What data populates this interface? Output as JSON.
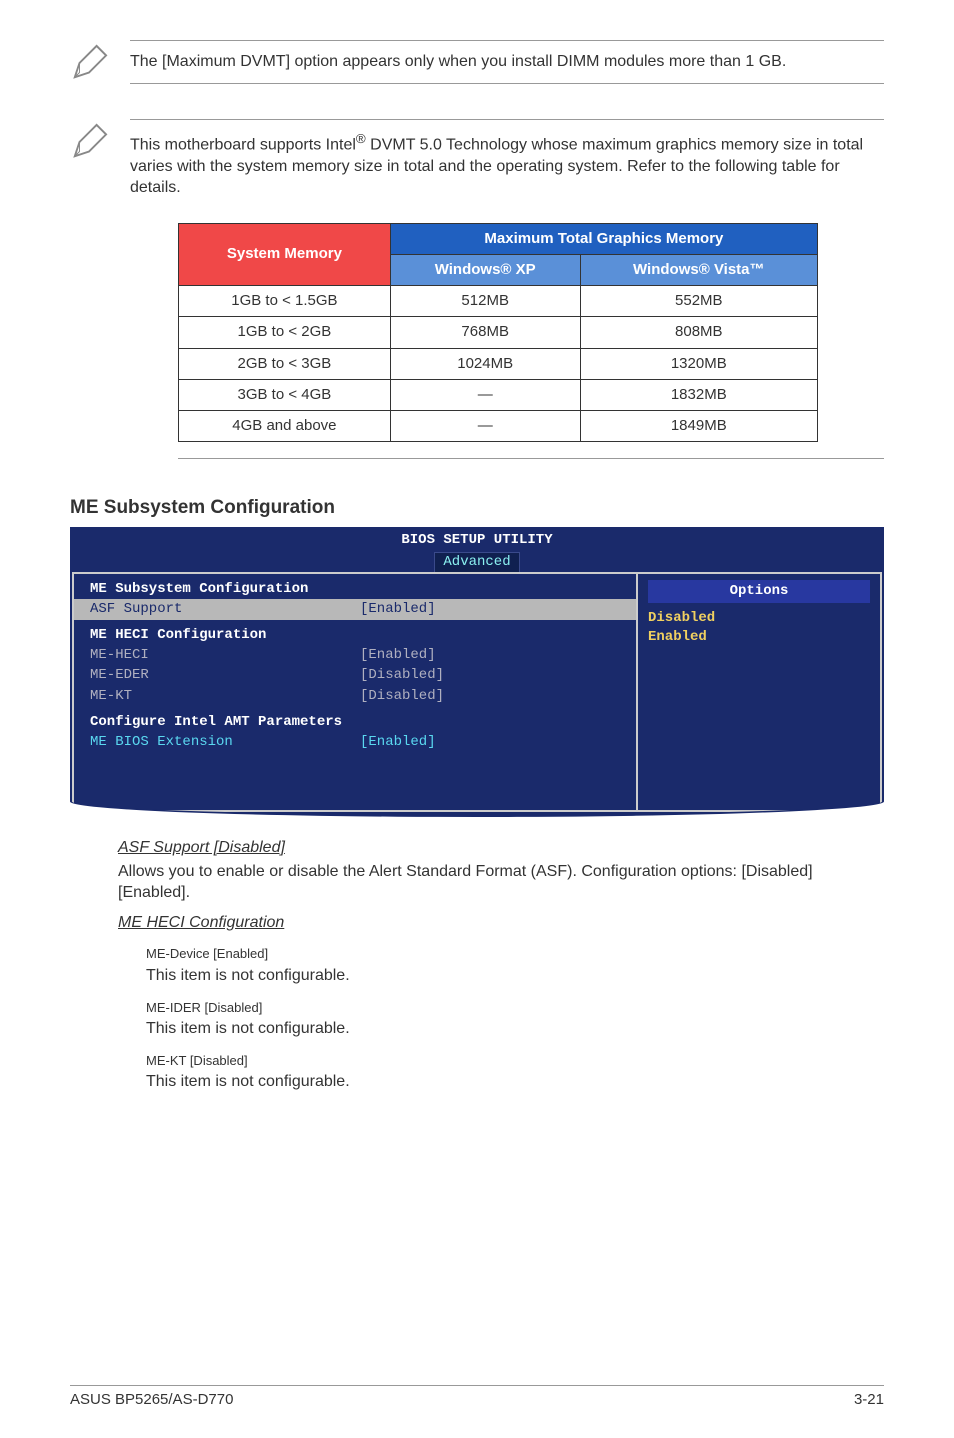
{
  "note1": "The [Maximum DVMT] option appears only when you install DIMM modules more than 1 GB.",
  "note2": {
    "pre": "This motherboard supports Intel",
    "reg": "®",
    "post": " DVMT 5.0 Technology whose maximum graphics memory size in total varies with the system memory size in total and the operating system. Refer to the following table for details."
  },
  "table": {
    "h_sysmem": "System Memory",
    "h_max": "Maximum Total Graphics Memory",
    "h_winxp": "Windows® XP",
    "h_winvista": "Windows® Vista™",
    "rows": [
      {
        "mem": "1GB to < 1.5GB",
        "xp": "512MB",
        "vista": "552MB"
      },
      {
        "mem": "1GB to < 2GB",
        "xp": "768MB",
        "vista": "808MB"
      },
      {
        "mem": "2GB to < 3GB",
        "xp": "1024MB",
        "vista": "1320MB"
      },
      {
        "mem": "3GB to < 4GB",
        "xp": "—",
        "vista": "1832MB"
      },
      {
        "mem": "4GB and above",
        "xp": "—",
        "vista": "1849MB"
      }
    ]
  },
  "section_heading": "ME Subsystem Configuration",
  "bios": {
    "title": "BIOS SETUP UTILITY",
    "tab": "Advanced",
    "subheader": "ME Subsystem Configuration",
    "asf_label": "ASF Support",
    "asf_val": "[Enabled]",
    "heci_header": "ME HECI Configuration",
    "me_heci_l": "ME-HECI",
    "me_heci_v": "[Enabled]",
    "me_eder_l": "ME-EDER",
    "me_eder_v": "[Disabled]",
    "me_kt_l": "ME-KT",
    "me_kt_v": "[Disabled]",
    "conf_intel": "Configure Intel AMT Parameters",
    "me_bios_l": "ME BIOS Extension",
    "me_bios_v": "[Enabled]",
    "options_header": "Options",
    "opt1": "Disabled",
    "opt2": "Enabled"
  },
  "body": {
    "asf_head": "ASF Support [Disabled]",
    "asf_p1": "Allows you to enable or disable the Alert Standard Format (ASF). Configuration options: [Disabled] [Enabled].",
    "heci_head": "ME HECI Configuration",
    "me_dev": "ME-Device [Enabled]",
    "not_conf": "This item is not configurable.",
    "me_ider": "ME-IDER [Disabled]",
    "me_kt": "ME-KT [Disabled]"
  },
  "footer": {
    "left": "ASUS BP5265/AS-D770",
    "right": "3-21"
  }
}
